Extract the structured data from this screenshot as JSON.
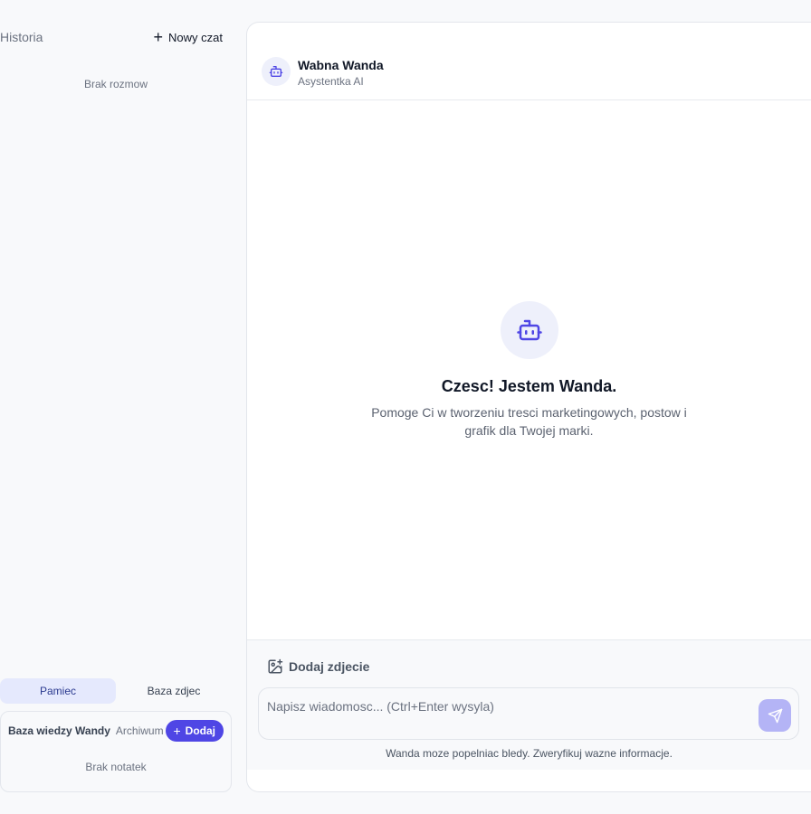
{
  "sidebar": {
    "title": "Historia",
    "new_chat_label": "Nowy czat",
    "empty_history": "Brak rozmow",
    "tabs": [
      {
        "label": "Pamiec",
        "active": true
      },
      {
        "label": "Baza zdjec",
        "active": false
      }
    ],
    "knowledge": {
      "title": "Baza wiedzy Wandy",
      "archive_label": "Archiwum",
      "add_label": "Dodaj",
      "empty": "Brak notatek"
    }
  },
  "chat": {
    "agent_name": "Wabna Wanda",
    "agent_subtitle": "Asystentka AI",
    "welcome_title": "Czesc! Jestem Wanda.",
    "welcome_text": "Pomoge Ci w tworzeniu tresci marketingowych, postow i grafik dla Twojej marki.",
    "add_photo_label": "Dodaj zdjecie",
    "input_placeholder": "Napisz wiadomosc... (Ctrl+Enter wysyla)",
    "input_value": "",
    "disclaimer": "Wanda moze popelniac bledy. Zweryfikuj wazne informacje."
  },
  "colors": {
    "accent": "#4f46e5",
    "send_button": "#b4b4f6",
    "active_tab_bg": "#e5e9fd",
    "background": "#f8f9fb"
  },
  "icons": {
    "new_chat": "plus-icon",
    "agent": "robot-icon",
    "add_photo": "image-plus-icon",
    "send": "send-icon",
    "add": "plus-icon"
  }
}
